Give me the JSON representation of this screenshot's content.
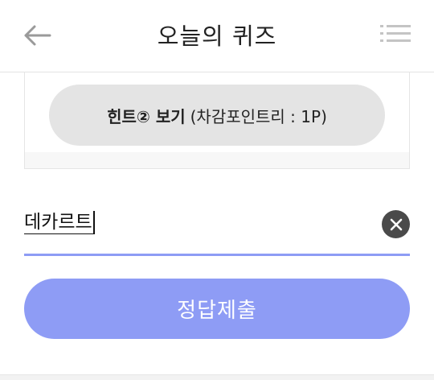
{
  "header": {
    "title": "오늘의 퀴즈",
    "back_icon": "arrow-left-icon",
    "menu_icon": "list-menu-icon"
  },
  "hint": {
    "label": "힌트② 보기",
    "cost": "(차감포인트리 : 1P)"
  },
  "answer": {
    "value": "데카르트",
    "clear_icon": "clear-x-icon"
  },
  "submit": {
    "label": "정답제출"
  },
  "colors": {
    "accent": "#8e9cf5",
    "hint_bg": "#e4e4e4",
    "clear_bg": "#4a4a4a"
  }
}
